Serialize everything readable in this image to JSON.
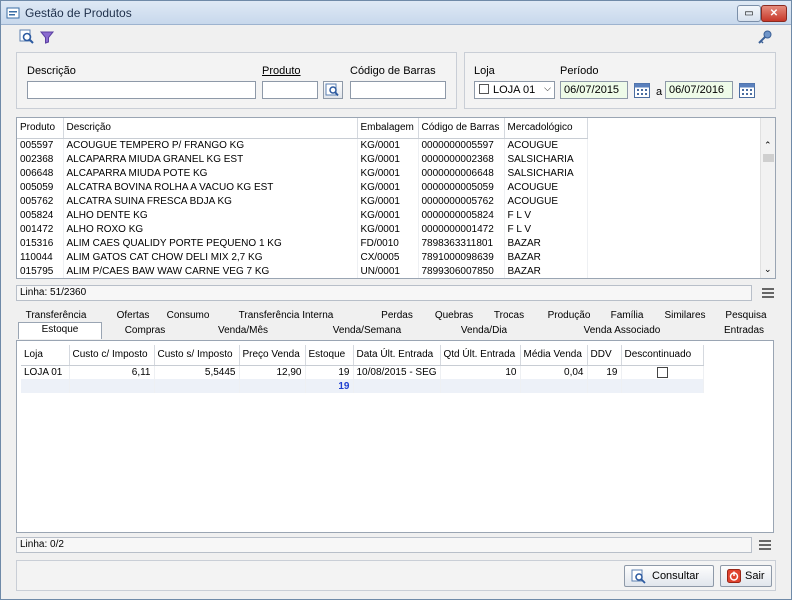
{
  "window": {
    "title": "Gestão de Produtos",
    "min_label": "▭",
    "close_label": "✕"
  },
  "toolbar": {
    "search_icon": "search-icon",
    "filter_icon": "filter-icon",
    "key_icon": "key-icon"
  },
  "filters": {
    "descricao_label": "Descrição",
    "produto_label": "Produto",
    "codigo_barras_label": "Código de Barras",
    "loja_label": "Loja",
    "loja_value": "LOJA 01",
    "periodo_label": "Período",
    "periodo_de": "06/07/2015",
    "periodo_sep": "a",
    "periodo_ate": "06/07/2016"
  },
  "products": {
    "columns": [
      "Produto",
      "Descrição",
      "Embalagem",
      "Código de Barras",
      "Mercadológico"
    ],
    "rows": [
      [
        "005597",
        "ACOUGUE TEMPERO P/ FRANGO KG",
        "KG/0001",
        "0000000005597",
        "ACOUGUE"
      ],
      [
        "002368",
        "ALCAPARRA MIUDA GRANEL KG EST",
        "KG/0001",
        "0000000002368",
        "SALSICHARIA"
      ],
      [
        "006648",
        "ALCAPARRA MIUDA POTE KG",
        "KG/0001",
        "0000000006648",
        "SALSICHARIA"
      ],
      [
        "005059",
        "ALCATRA BOVINA ROLHA A VACUO KG EST",
        "KG/0001",
        "0000000005059",
        "ACOUGUE"
      ],
      [
        "005762",
        "ALCATRA SUINA FRESCA BDJA KG",
        "KG/0001",
        "0000000005762",
        "ACOUGUE"
      ],
      [
        "005824",
        "ALHO DENTE KG",
        "KG/0001",
        "0000000005824",
        "F L V"
      ],
      [
        "001472",
        "ALHO ROXO KG",
        "KG/0001",
        "0000000001472",
        "F L V"
      ],
      [
        "015316",
        "ALIM CAES QUALIDY PORTE PEQUENO 1 KG",
        "FD/0010",
        "7898363311801",
        "BAZAR"
      ],
      [
        "110044",
        "ALIM GATOS CAT CHOW DELI MIX 2,7 KG",
        "CX/0005",
        "7891000098639",
        "BAZAR"
      ],
      [
        "015795",
        "ALIM P/CAES BAW WAW CARNE VEG 7 KG",
        "UN/0001",
        "7899306007850",
        "BAZAR"
      ]
    ],
    "status": "Linha: 51/2360"
  },
  "tabs": {
    "row1": [
      "Transferência",
      "Ofertas",
      "Consumo",
      "Transferência Interna",
      "Perdas",
      "Quebras",
      "Trocas",
      "Produção",
      "Família",
      "Similares",
      "Pesquisa"
    ],
    "row2": [
      "Estoque",
      "Compras",
      "Venda/Mês",
      "Venda/Semana",
      "Venda/Dia",
      "Venda Associado",
      "Entradas"
    ]
  },
  "stock": {
    "columns": [
      "Loja",
      "Custo c/ Imposto",
      "Custo s/ Imposto",
      "Preço Venda",
      "Estoque",
      "Data Últ. Entrada",
      "Qtd Últ. Entrada",
      "Média Venda",
      "DDV",
      "Descontinuado"
    ],
    "row": [
      "LOJA 01",
      "6,11",
      "5,5445",
      "12,90",
      "19",
      "10/08/2015 - SEG",
      "10",
      "0,04",
      "19"
    ],
    "total_estoque": "19",
    "status": "Linha: 0/2"
  },
  "buttons": {
    "consultar": "Consultar",
    "sair": "Sair"
  }
}
